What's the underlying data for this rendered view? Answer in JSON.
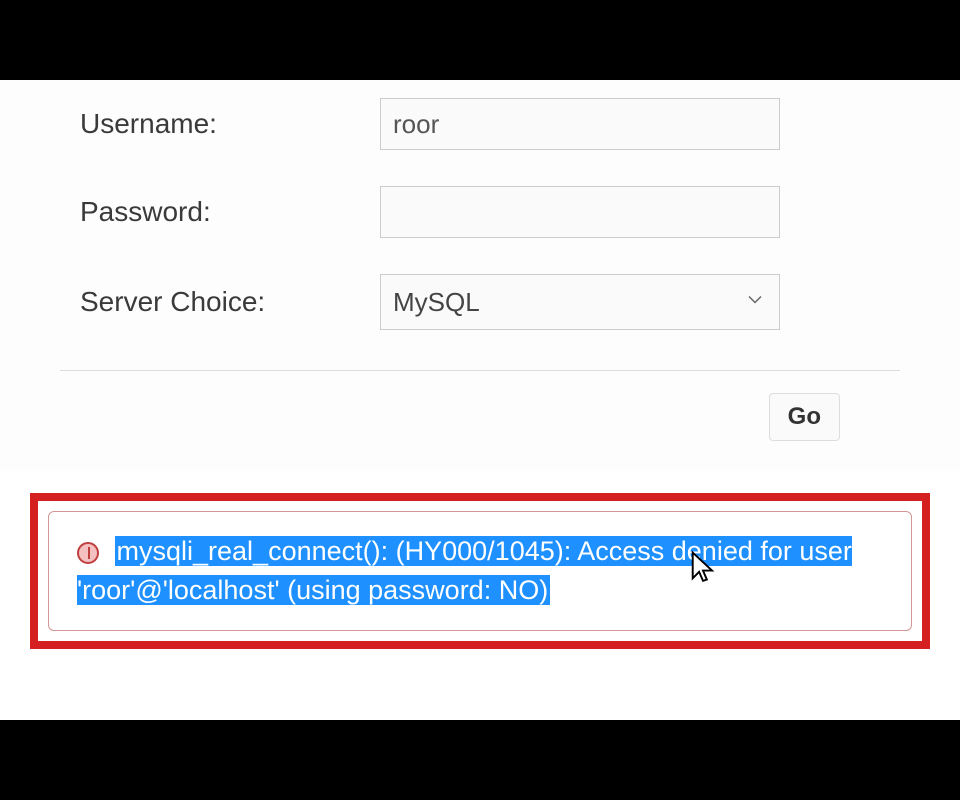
{
  "form": {
    "username": {
      "label": "Username:",
      "value": "roor"
    },
    "password": {
      "label": "Password:",
      "value": ""
    },
    "server": {
      "label": "Server Choice:",
      "selected": "MySQL"
    }
  },
  "actions": {
    "go": "Go"
  },
  "error": {
    "message": "mysqli_real_connect(): (HY000/1045): Access denied for user 'roor'@'localhost' (using password: NO)"
  }
}
